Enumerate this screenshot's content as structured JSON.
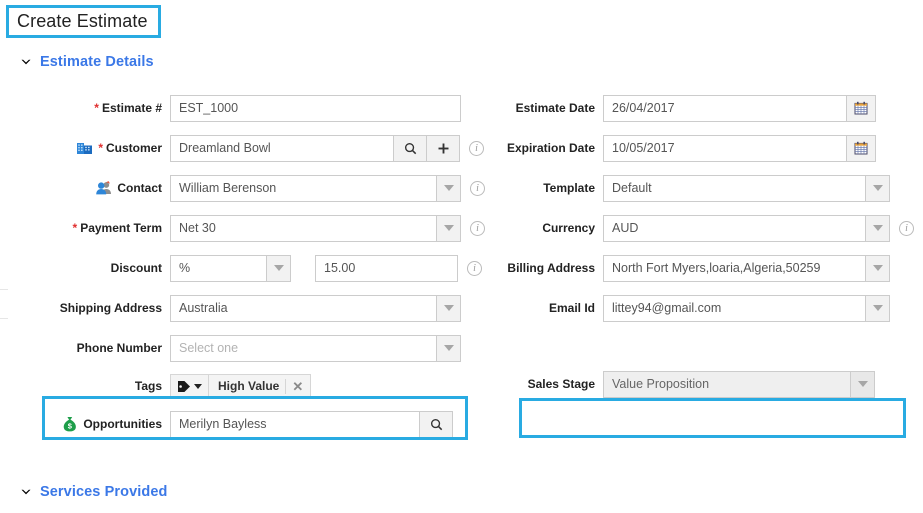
{
  "page": {
    "title": "Create Estimate"
  },
  "sections": [
    {
      "id": "estimate_details",
      "label": "Estimate Details",
      "chevron": "chevron-down-icon"
    },
    {
      "id": "services_provided",
      "label": "Services Provided",
      "chevron": "chevron-down-icon"
    }
  ],
  "left_column": {
    "estimate_number": {
      "label": "Estimate #",
      "required": true,
      "value": "EST_1000"
    },
    "customer": {
      "label": "Customer",
      "required": true,
      "icon": "building-icon",
      "value": "Dreamland Bowl",
      "search_icon": "search-icon",
      "add_icon": "plus-icon",
      "info_icon": "info-icon"
    },
    "contact": {
      "label": "Contact",
      "required": false,
      "icon": "people-icon",
      "value": "William Berenson",
      "caret_icon": "chevron-down-icon",
      "info_icon": "info-icon"
    },
    "payment_term": {
      "label": "Payment Term",
      "required": true,
      "value": "Net 30",
      "caret_icon": "chevron-down-icon",
      "info_icon": "info-icon"
    },
    "discount": {
      "label": "Discount",
      "type_value": "%",
      "amount_value": "15.00",
      "caret_icon": "chevron-down-icon",
      "info_icon": "info-icon"
    },
    "shipping_address": {
      "label": "Shipping Address",
      "value": "Australia",
      "caret_icon": "chevron-down-icon"
    },
    "phone_number": {
      "label": "Phone Number",
      "value": "",
      "placeholder": "Select one",
      "caret_icon": "chevron-down-icon"
    },
    "tags": {
      "label": "Tags",
      "tag_icon": "tag-icon",
      "caret_icon": "chevron-down-icon",
      "chips": [
        {
          "label": "High Value",
          "remove_icon": "close-icon"
        }
      ]
    },
    "opportunities": {
      "label": "Opportunities",
      "icon": "money-bag-icon",
      "value": "Merilyn Bayless",
      "search_icon": "search-icon",
      "highlighted": true
    }
  },
  "right_column": {
    "estimate_date": {
      "label": "Estimate Date",
      "value": "26/04/2017",
      "calendar_icon": "calendar-icon"
    },
    "expiration_date": {
      "label": "Expiration Date",
      "value": "10/05/2017",
      "calendar_icon": "calendar-icon"
    },
    "template": {
      "label": "Template",
      "value": "Default",
      "caret_icon": "chevron-down-icon"
    },
    "currency": {
      "label": "Currency",
      "value": "AUD",
      "caret_icon": "chevron-down-icon",
      "info_icon": "info-icon"
    },
    "billing_address": {
      "label": "Billing Address",
      "value": "North Fort Myers,loaria,Algeria,50259",
      "caret_icon": "chevron-down-icon"
    },
    "email_id": {
      "label": "Email Id",
      "value": "littey94@gmail.com",
      "caret_icon": "chevron-down-icon"
    },
    "sales_stage": {
      "label": "Sales Stage",
      "value": "Value Proposition",
      "caret_icon": "chevron-down-icon",
      "disabled": true,
      "highlighted": true
    }
  },
  "colors": {
    "highlight": "#29ABE2",
    "section_link": "#3B78E7",
    "required_asterisk": "#E02F2F",
    "field_border": "#CCCCCC",
    "addon_background": "#F2F2F2"
  }
}
